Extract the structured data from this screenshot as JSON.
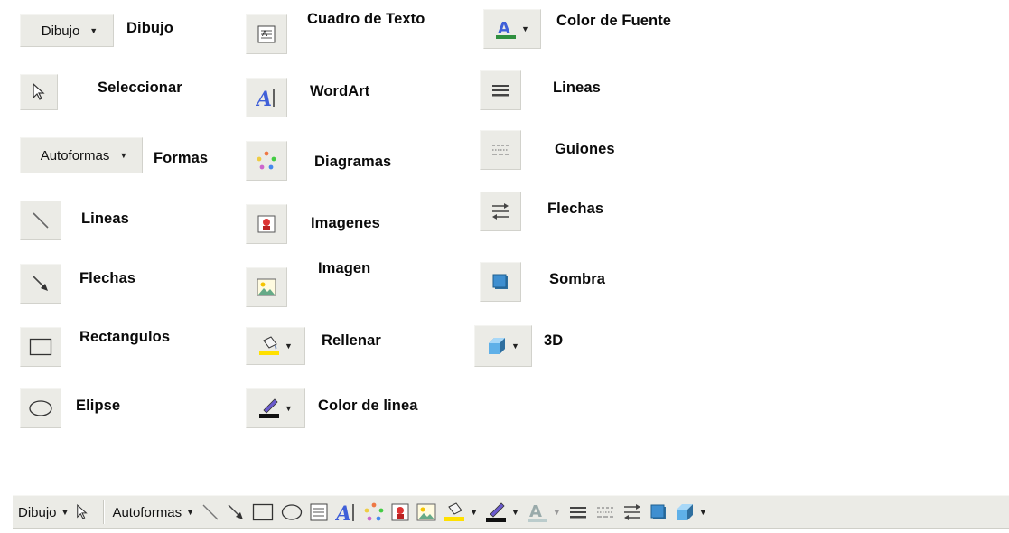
{
  "buttons": {
    "dibujo_menu": "Dibujo",
    "autoformas_menu": "Autoformas"
  },
  "labels": {
    "dibujo": "Dibujo",
    "seleccionar": "Seleccionar",
    "formas": "Formas",
    "lineas": "Lineas",
    "flechas": "Flechas",
    "rectangulos": "Rectangulos",
    "elipse": "Elipse",
    "cuadro_texto": "Cuadro de Texto",
    "wordart": "WordArt",
    "diagramas": "Diagramas",
    "imagenes": "Imagenes",
    "imagen": "Imagen",
    "rellenar": "Rellenar",
    "color_linea": "Color de linea",
    "color_fuente": "Color de Fuente",
    "lineas_estilo": "Lineas",
    "guiones": "Guiones",
    "flechas_estilo": "Flechas",
    "sombra": "Sombra",
    "tres_d": "3D"
  },
  "toolbar": {
    "dibujo_label": "Dibujo",
    "autoformas_label": "Autoformas"
  },
  "colors": {
    "toolbar_bg": "#ebebe6",
    "fill_yellow": "#ffe000",
    "font_color": "#2f8f3f",
    "wordart_blue": "#3f5fd8",
    "shadow_blue": "#3f8fd0"
  }
}
